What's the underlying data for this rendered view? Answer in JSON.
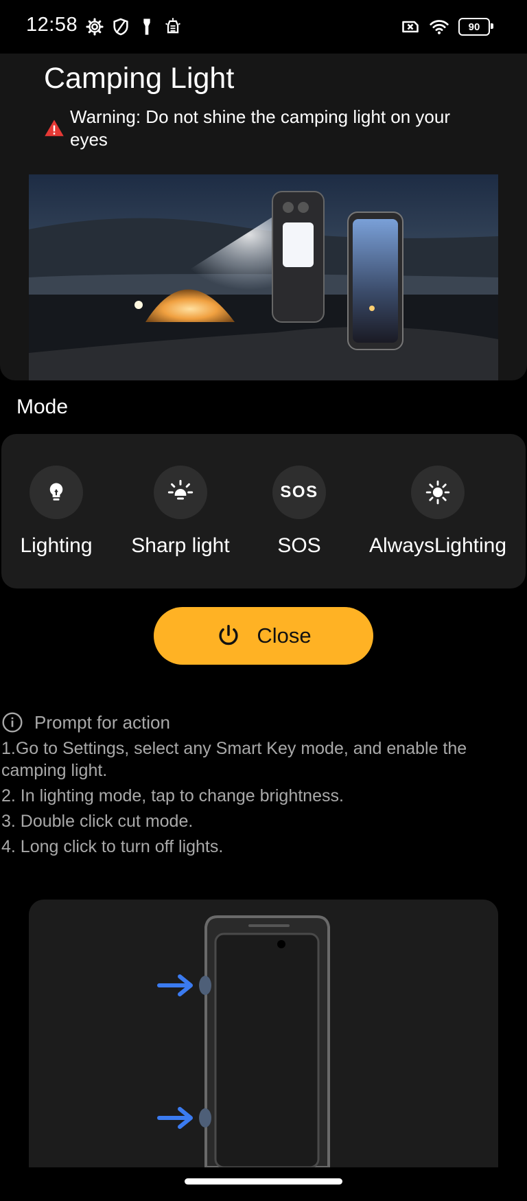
{
  "status_bar": {
    "time": "12:58",
    "battery": "90",
    "left_icons": [
      "gear-icon",
      "shield-icon",
      "flashlight-icon",
      "camping-light-icon"
    ],
    "right_icons": [
      "sim-off-icon",
      "wifi-icon",
      "battery-icon"
    ]
  },
  "header": {
    "title": "Camping Light",
    "warning": "Warning: Do not shine the camping light on your eyes"
  },
  "mode": {
    "title": "Mode",
    "items": [
      {
        "label": "Lighting",
        "icon": "bulb-icon"
      },
      {
        "label": "Sharp light",
        "icon": "sharp-light-icon"
      },
      {
        "label": "SOS",
        "icon": "sos-icon",
        "glyph": "SOS"
      },
      {
        "label": "AlwaysLighting",
        "icon": "sun-icon"
      }
    ]
  },
  "close_button": {
    "label": "Close",
    "icon": "power-icon",
    "color": "#ffb224"
  },
  "prompt": {
    "title": "Prompt for action",
    "lines": [
      "1.Go to Settings, select any Smart Key mode, and enable the camping light.",
      "2. In lighting mode, tap to change brightness.",
      "3. Double click cut mode.",
      "4. Long click to turn off lights."
    ]
  },
  "colors": {
    "accent": "#ffb224",
    "arrow": "#3b7bf0",
    "warning": "#e53935",
    "panel": "#1c1c1c"
  }
}
